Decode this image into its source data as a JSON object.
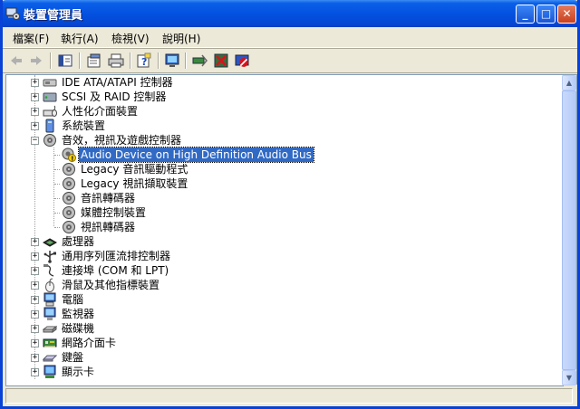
{
  "window": {
    "title": "裝置管理員"
  },
  "title_buttons": {
    "minimize": "_",
    "maximize": "□",
    "close": "✕"
  },
  "menu": [
    {
      "label": "檔案(F)"
    },
    {
      "label": "執行(A)"
    },
    {
      "label": "檢視(V)"
    },
    {
      "label": "說明(H)"
    }
  ],
  "toolbar": {
    "buttons": [
      "back-icon",
      "forward-icon",
      "console-tree-icon",
      "properties-icon",
      "print-icon",
      "help-icon",
      "device-icon",
      "scan-hardware-icon",
      "uninstall-icon",
      "disable-icon"
    ]
  },
  "tree": {
    "items": [
      {
        "label": "IDE ATA/ATAPI 控制器",
        "level": 0,
        "expander": "+",
        "icon": "ide-controller-icon"
      },
      {
        "label": "SCSI 及 RAID 控制器",
        "level": 0,
        "expander": "+",
        "icon": "scsi-controller-icon"
      },
      {
        "label": "人性化介面裝置",
        "level": 0,
        "expander": "+",
        "icon": "hid-icon"
      },
      {
        "label": "系統裝置",
        "level": 0,
        "expander": "+",
        "icon": "system-device-icon"
      },
      {
        "label": "音效，視訊及遊戲控制器",
        "level": 0,
        "expander": "−",
        "icon": "sound-controller-icon"
      },
      {
        "label": "Audio Device on High Definition Audio Bus",
        "level": 1,
        "icon": "warning-audio-device-icon",
        "selected": true
      },
      {
        "label": "Legacy 音訊驅動程式",
        "level": 1,
        "icon": "audio-device-icon"
      },
      {
        "label": "Legacy 視訊擷取裝置",
        "level": 1,
        "icon": "audio-device-icon"
      },
      {
        "label": "音訊轉碼器",
        "level": 1,
        "icon": "audio-device-icon"
      },
      {
        "label": "媒體控制裝置",
        "level": 1,
        "icon": "audio-device-icon"
      },
      {
        "label": "視訊轉碼器",
        "level": 1,
        "icon": "audio-device-icon"
      },
      {
        "label": "處理器",
        "level": 0,
        "expander": "+",
        "icon": "processor-icon"
      },
      {
        "label": "通用序列匯流排控制器",
        "level": 0,
        "expander": "+",
        "icon": "usb-icon"
      },
      {
        "label": "連接埠 (COM 和 LPT)",
        "level": 0,
        "expander": "+",
        "icon": "port-icon"
      },
      {
        "label": "滑鼠及其他指標裝置",
        "level": 0,
        "expander": "+",
        "icon": "mouse-icon"
      },
      {
        "label": "電腦",
        "level": 0,
        "expander": "+",
        "icon": "computer-icon"
      },
      {
        "label": "監視器",
        "level": 0,
        "expander": "+",
        "icon": "monitor-icon"
      },
      {
        "label": "磁碟機",
        "level": 0,
        "expander": "+",
        "icon": "disk-drive-icon"
      },
      {
        "label": "網路介面卡",
        "level": 0,
        "expander": "+",
        "icon": "network-adapter-icon"
      },
      {
        "label": "鍵盤",
        "level": 0,
        "expander": "+",
        "icon": "keyboard-icon"
      },
      {
        "label": "顯示卡",
        "level": 0,
        "expander": "+",
        "icon": "display-adapter-icon"
      }
    ]
  },
  "scrollbar": {
    "up": "▲",
    "down": "▼"
  },
  "colors": {
    "titlebar": "#0452e0",
    "selection": "#316ac5",
    "window_bg": "#ece9d8"
  }
}
